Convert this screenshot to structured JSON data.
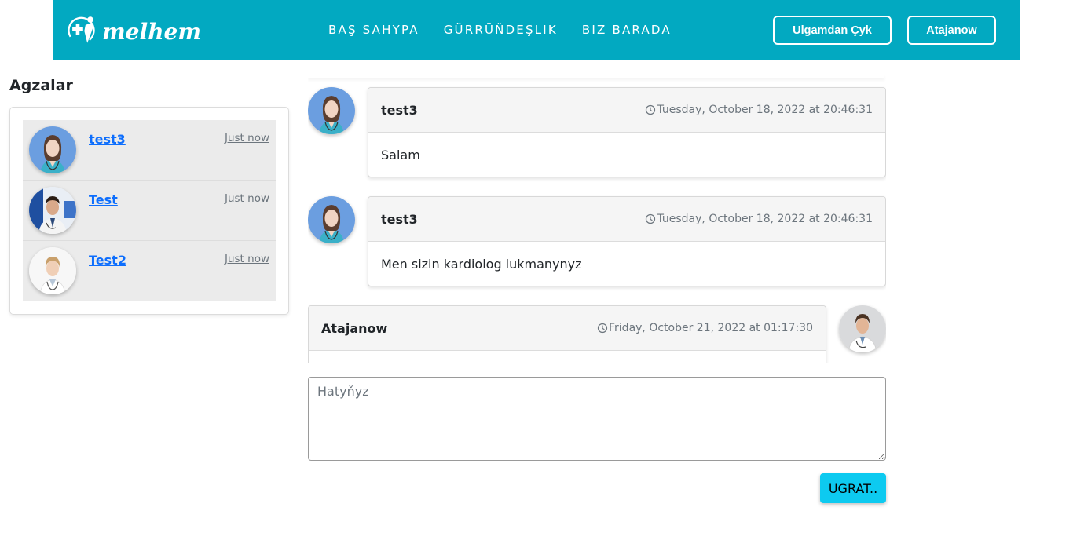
{
  "brand": {
    "logo_text": "melhem"
  },
  "nav": {
    "links": [
      "BAŞ SAHYPA",
      "GÜRRÜŇDEŞLIK",
      "BIZ BARADA"
    ],
    "logout_label": "Ulgamdan Çyk",
    "user_label": "Atajanow"
  },
  "sidebar": {
    "title": "Agzalar",
    "members": [
      {
        "name": "test3",
        "time": "Just now",
        "avatar": "female-doctor-blue"
      },
      {
        "name": "Test",
        "time": "Just now",
        "avatar": "male-doctor-lab"
      },
      {
        "name": "Test2",
        "time": "Just now",
        "avatar": "female-doctor-white"
      }
    ]
  },
  "messages": [
    {
      "author": "test3",
      "time": "Tuesday, October 18, 2022 at 20:46:31",
      "text": "Salam",
      "side": "left",
      "avatar": "female-doctor-blue"
    },
    {
      "author": "test3",
      "time": "Tuesday, October 18, 2022 at 20:46:31",
      "text": "Men sizin kardiolog lukmanynyz",
      "side": "left",
      "avatar": "female-doctor-blue"
    },
    {
      "author": "Atajanow",
      "time": "Friday, October 21, 2022 at 01:17:30",
      "text": "",
      "side": "right",
      "avatar": "male-doctor-white"
    }
  ],
  "composer": {
    "placeholder": "Hatyňyz",
    "value": "",
    "send_label": "UGRAT.."
  },
  "colors": {
    "navbar": "#02a9c1",
    "send_button": "#0dcaf0",
    "link": "#0d6efd"
  }
}
